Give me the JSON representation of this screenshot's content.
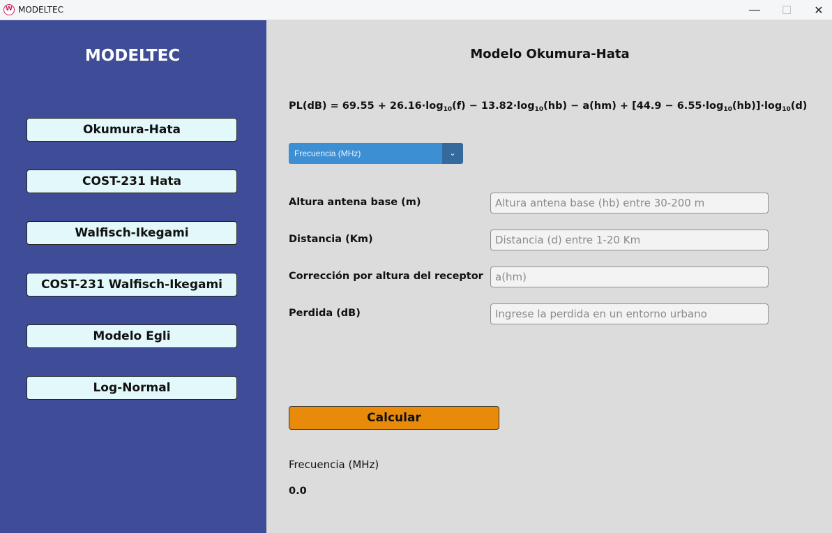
{
  "window": {
    "icon_text": "W",
    "title": "MODELTEC",
    "minimize_glyph": "—",
    "maximize_glyph": "☐",
    "close_glyph": "✕"
  },
  "sidebar": {
    "brand": "MODELTEC",
    "items": [
      {
        "label": "Okumura-Hata"
      },
      {
        "label": "COST-231 Hata"
      },
      {
        "label": "Walfisch-Ikegami"
      },
      {
        "label": "COST-231 Walfisch-Ikegami"
      },
      {
        "label": "Modelo Egli"
      },
      {
        "label": "Log-Normal"
      }
    ]
  },
  "main": {
    "title": "Modelo Okumura-Hata",
    "formula": {
      "p1": "PL(dB) = 69.55 + 26.16·log",
      "s1": "10",
      "p2": "(f) − 13.82·log",
      "s2": "10",
      "p3": "(hb) − a(hm) + [44.9 − 6.55·log",
      "s3": "10",
      "p4": "(hb)]·log",
      "s4": "10",
      "p5": "(d)"
    },
    "select": {
      "value": "Frecuencia (MHz)",
      "arrow": "⌄"
    },
    "fields": [
      {
        "label": "Altura antena base (m)",
        "placeholder": "Altura antena base (hb) entre 30-200 m"
      },
      {
        "label": "Distancia (Km)",
        "placeholder": "Distancia (d) entre 1-20 Km"
      },
      {
        "label": "Corrección por altura del receptor",
        "placeholder": "a(hm)"
      },
      {
        "label": "Perdida (dB)",
        "placeholder": "Ingrese la perdida en un entorno urbano"
      }
    ],
    "calculate_label": "Calcular",
    "result_label": "Frecuencia (MHz)",
    "result_value": "0.0"
  },
  "colors": {
    "sidebar_bg": "#3f4d98",
    "nav_button_bg": "#e3f8fb",
    "main_bg": "#dcdcdc",
    "select_bg": "#3d8fd4",
    "calculate_bg": "#e98b0a"
  }
}
